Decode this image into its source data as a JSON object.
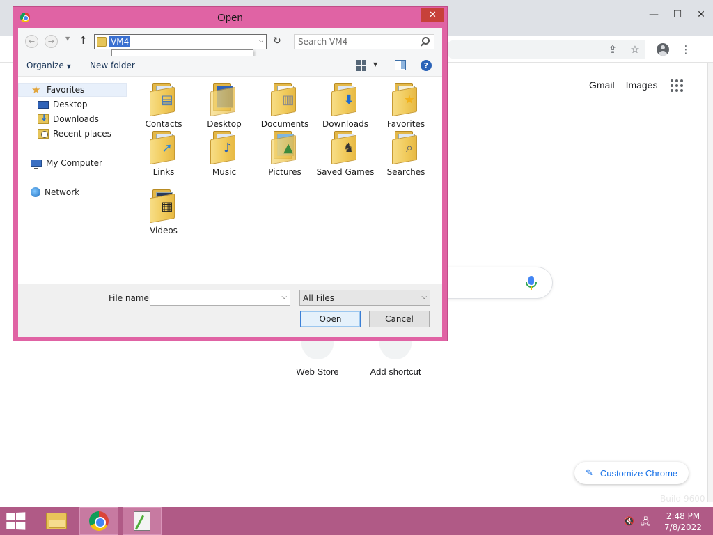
{
  "background_window": {
    "app": "Google Chrome",
    "header_links": [
      "Gmail",
      "Images"
    ],
    "shortcuts": [
      {
        "label": "Web Store"
      },
      {
        "label": "Add shortcut"
      }
    ],
    "customize_label": "Customize Chrome",
    "build_text": "Build 9600"
  },
  "dialog": {
    "title": "Open",
    "address": {
      "current": "VM4"
    },
    "search": {
      "placeholder": "Search VM4"
    },
    "toolbar": {
      "organize": "Organize",
      "new_folder": "New folder"
    },
    "nav_pane": {
      "favorites": "Favorites",
      "favorites_items": [
        "Desktop",
        "Downloads",
        "Recent places"
      ],
      "my_computer": "My Computer",
      "network": "Network"
    },
    "items": [
      {
        "name": "Contacts",
        "icon": "contacts-folder-icon"
      },
      {
        "name": "Desktop",
        "icon": "desktop-folder-icon"
      },
      {
        "name": "Documents",
        "icon": "documents-folder-icon"
      },
      {
        "name": "Downloads",
        "icon": "downloads-folder-icon"
      },
      {
        "name": "Favorites",
        "icon": "favorites-folder-icon"
      },
      {
        "name": "Links",
        "icon": "links-folder-icon"
      },
      {
        "name": "Music",
        "icon": "music-folder-icon"
      },
      {
        "name": "Pictures",
        "icon": "pictures-folder-icon"
      },
      {
        "name": "Saved Games",
        "icon": "saved-games-folder-icon"
      },
      {
        "name": "Searches",
        "icon": "searches-folder-icon"
      },
      {
        "name": "Videos",
        "icon": "videos-folder-icon"
      }
    ],
    "file_name_label": "File name:",
    "file_name_value": "",
    "file_type": "All Files",
    "open_label": "Open",
    "cancel_label": "Cancel"
  },
  "taskbar": {
    "time": "2:48 PM",
    "date": "7/8/2022",
    "apps": [
      "file-explorer",
      "google-chrome",
      "notepad"
    ]
  },
  "colors": {
    "dialog_frame": "#e063a4",
    "taskbar": "#b05a86",
    "selection": "#3a70d0",
    "accent": "#1a73e8"
  }
}
